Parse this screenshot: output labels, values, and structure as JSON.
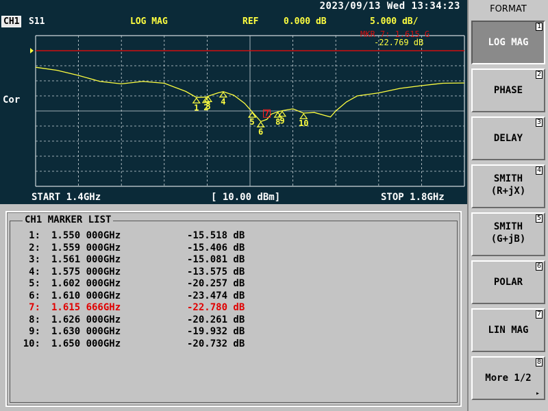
{
  "status": {
    "datetime": "2023/09/13 Wed 13:34:23"
  },
  "header": {
    "channel": "CH1",
    "parameter": "S11",
    "format": "LOG MAG",
    "ref_label": "REF",
    "ref_value": "0.000 dB",
    "scale": "5.000 dB/"
  },
  "side_label": "Cor",
  "active_marker_readout": {
    "label": "MKR  7:  1.615 G",
    "value": "-22.769 dB"
  },
  "sweep": {
    "start": "START 1.4GHz",
    "power": "[ 10.00 dBm]",
    "stop": "STOP 1.8GHz"
  },
  "marker_list": {
    "title": "CH1 MARKER LIST",
    "rows": [
      {
        "num": "1:",
        "freq": "1.550 000GHz",
        "value": "-15.518 dB"
      },
      {
        "num": "2:",
        "freq": "1.559 000GHz",
        "value": "-15.406 dB"
      },
      {
        "num": "3:",
        "freq": "1.561 000GHz",
        "value": "-15.081 dB"
      },
      {
        "num": "4:",
        "freq": "1.575 000GHz",
        "value": "-13.575 dB"
      },
      {
        "num": "5:",
        "freq": "1.602 000GHz",
        "value": "-20.257 dB"
      },
      {
        "num": "6:",
        "freq": "1.610 000GHz",
        "value": "-23.474 dB"
      },
      {
        "num": "7:",
        "freq": "1.615 666GHz",
        "value": "-22.780 dB"
      },
      {
        "num": "8:",
        "freq": "1.626 000GHz",
        "value": "-20.261 dB"
      },
      {
        "num": "9:",
        "freq": "1.630 000GHz",
        "value": "-19.932 dB"
      },
      {
        "num": "10:",
        "freq": "1.650 000GHz",
        "value": "-20.732 dB"
      }
    ],
    "active_index": 6
  },
  "softkeys": {
    "title": "FORMAT",
    "items": [
      {
        "l1": "LOG MAG",
        "l2": "",
        "num": "1"
      },
      {
        "l1": "PHASE",
        "l2": "",
        "num": "2"
      },
      {
        "l1": "DELAY",
        "l2": "",
        "num": "3"
      },
      {
        "l1": "SMITH",
        "l2": "(R+jX)",
        "num": "4"
      },
      {
        "l1": "SMITH",
        "l2": "(G+jB)",
        "num": "5"
      },
      {
        "l1": "POLAR",
        "l2": "",
        "num": "6"
      },
      {
        "l1": "LIN MAG",
        "l2": "",
        "num": "7"
      },
      {
        "l1": "More 1/2",
        "l2": "",
        "num": "8"
      }
    ],
    "selected_index": 0,
    "more_arrow": "▸"
  },
  "colors": {
    "screen_bg": "#0b2a38",
    "grid": "#cfd8dc",
    "trace": "#ffff40",
    "ref_line": "#d01010",
    "marker": "#ffff40",
    "active_marker": "#ff2020"
  },
  "chart_data": {
    "type": "line",
    "x_unit": "GHz",
    "y_unit": "dB",
    "xlim": [
      1.4,
      1.8
    ],
    "ylim": [
      -45,
      5
    ],
    "reference_level": 0,
    "grid": true,
    "series": [
      {
        "x": [
          1.4,
          1.42,
          1.44,
          1.46,
          1.48,
          1.5,
          1.52,
          1.54,
          1.55,
          1.559,
          1.561,
          1.57,
          1.575,
          1.585,
          1.595,
          1.602,
          1.61,
          1.6157,
          1.62,
          1.626,
          1.63,
          1.64,
          1.65,
          1.66,
          1.67,
          1.675,
          1.68,
          1.69,
          1.7,
          1.72,
          1.74,
          1.76,
          1.78,
          1.8
        ],
        "y": [
          -5.5,
          -6.5,
          -8.2,
          -10.2,
          -11.0,
          -10.2,
          -10.8,
          -13.5,
          -15.5,
          -15.4,
          -15.1,
          -14.0,
          -13.6,
          -14.8,
          -17.5,
          -20.3,
          -23.5,
          -22.8,
          -21.0,
          -20.3,
          -19.9,
          -19.3,
          -20.7,
          -20.5,
          -21.5,
          -22.0,
          -20.0,
          -17.0,
          -15.0,
          -14.0,
          -12.5,
          -11.6,
          -10.8,
          -10.7
        ]
      }
    ],
    "markers": [
      {
        "label": "1",
        "x": 1.55,
        "y": -15.518
      },
      {
        "label": "2",
        "x": 1.559,
        "y": -15.406
      },
      {
        "label": "3",
        "x": 1.561,
        "y": -15.081
      },
      {
        "label": "4",
        "x": 1.575,
        "y": -13.575
      },
      {
        "label": "5",
        "x": 1.602,
        "y": -20.257
      },
      {
        "label": "6",
        "x": 1.61,
        "y": -23.474
      },
      {
        "label": "7",
        "x": 1.615666,
        "y": -22.78
      },
      {
        "label": "8",
        "x": 1.626,
        "y": -20.261
      },
      {
        "label": "9",
        "x": 1.63,
        "y": -19.932
      },
      {
        "label": "10",
        "x": 1.65,
        "y": -20.732
      }
    ]
  }
}
